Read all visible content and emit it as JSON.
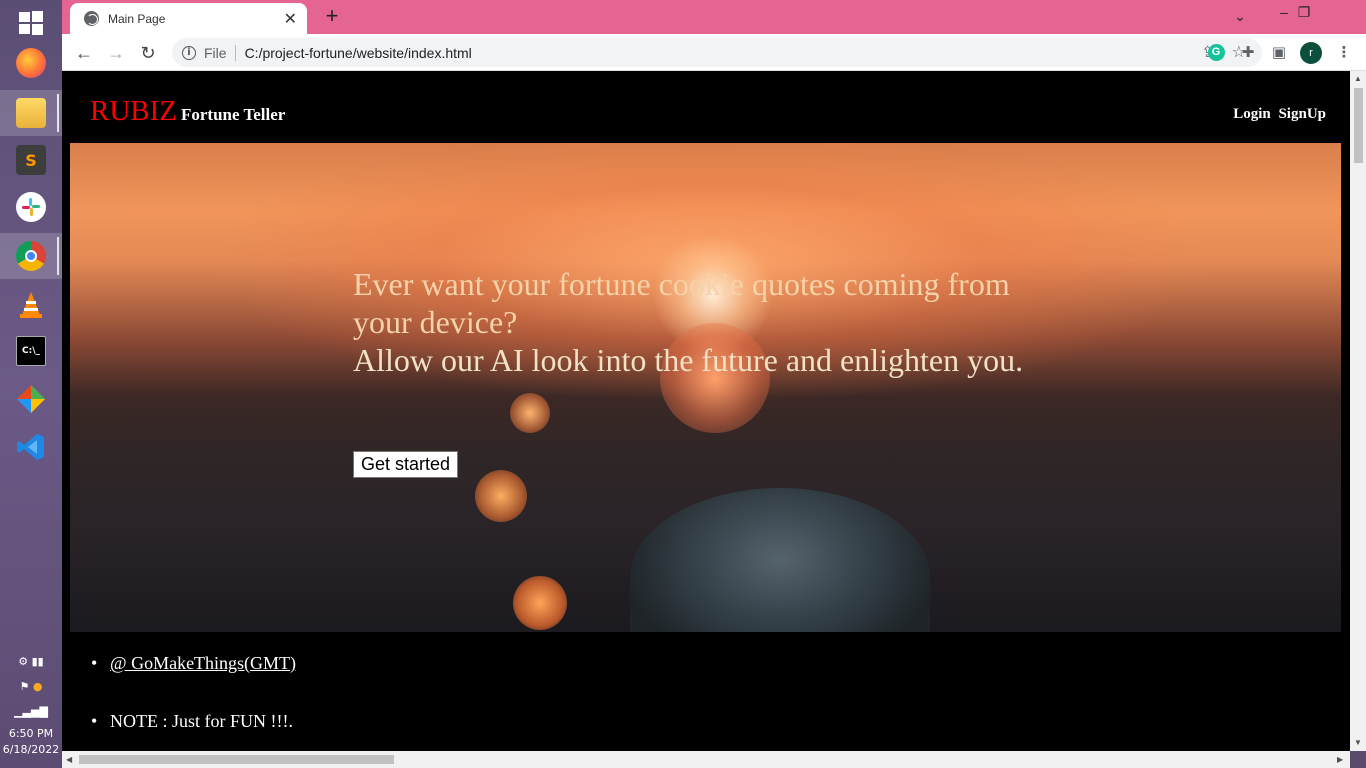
{
  "system": {
    "taskbar_apps": [
      "Start",
      "Firefox",
      "File Explorer",
      "Sublime Text",
      "Slack",
      "Chrome",
      "VLC",
      "Terminal",
      "Git",
      "VS Code"
    ],
    "clock_time": "6:50 PM",
    "clock_date": "6/18/2022"
  },
  "browser": {
    "tab_title": "Main Page",
    "url_chip": "File",
    "url": "C:/project-fortune/website/index.html",
    "profile_initial": "r",
    "accent_color": "#e56592"
  },
  "site": {
    "brand_main": "RUBIZ",
    "brand_sub": "Fortune Teller",
    "login": "Login",
    "signup": "SignUp",
    "hero_line1": "Ever want your fortune cookie quotes coming from your device?",
    "hero_line2": "Allow our AI look into the future and enlighten you.",
    "cta": "Get started",
    "footer_link": "@ GoMakeThings(GMT)",
    "footer_note": "NOTE : Just for FUN !!!."
  }
}
